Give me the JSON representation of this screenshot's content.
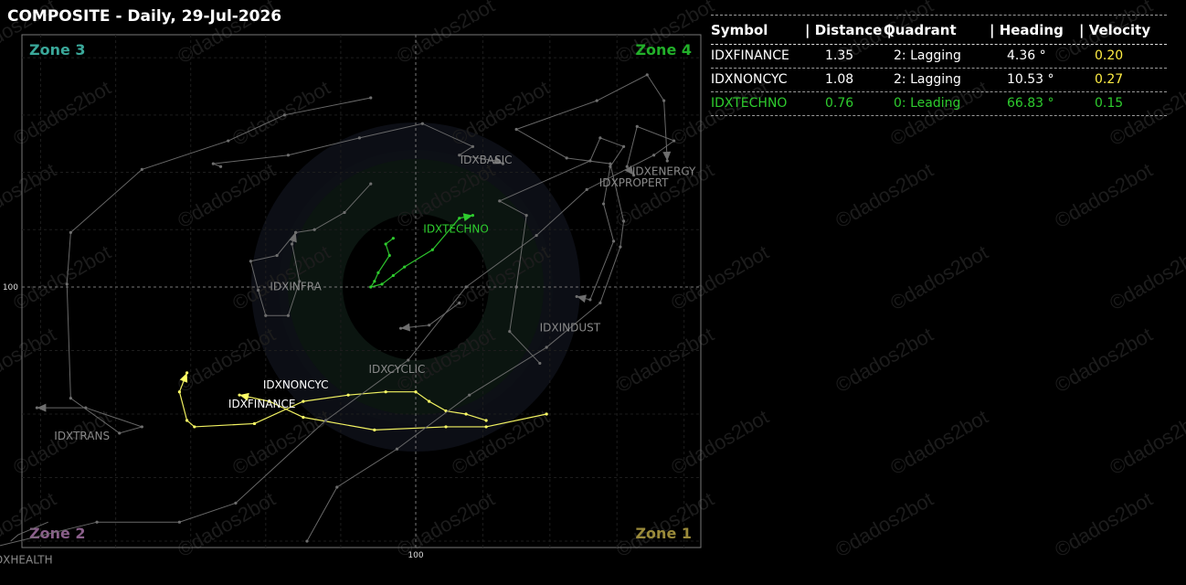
{
  "title": "COMPOSITE - Daily, 29-Jul-2026",
  "watermark": "©dados2bot",
  "chart_data": {
    "type": "scatter",
    "title": "COMPOSITE - Daily, 29-Jul-2026",
    "x_center": 100,
    "y_center": 100,
    "x_tick_label": "100",
    "y_tick_label": "100",
    "xlim": [
      -10.5,
      8.5
    ],
    "ylim": [
      -8.2,
      8.8
    ],
    "grid": true,
    "zones": [
      {
        "label": "Zone 3",
        "position": "top-left",
        "color": "#3aa89a"
      },
      {
        "label": "Zone 4",
        "position": "top-right",
        "color": "#22b02a"
      },
      {
        "label": "Zone 2",
        "position": "bottom-left",
        "color": "#8a5f8a"
      },
      {
        "label": "Zone 1",
        "position": "bottom-right",
        "color": "#9a8a3a"
      }
    ],
    "series": [
      {
        "name": "IDXFINANCE",
        "color": "#ffff66",
        "width": 1.2,
        "dots": true,
        "head": true,
        "points": [
          [
            3.9,
            -4
          ],
          [
            2.1,
            -4.4
          ],
          [
            0.9,
            -4.4
          ],
          [
            -1.1,
            -4.5
          ],
          [
            -3,
            -4.1
          ],
          [
            -3.9,
            -3.6
          ],
          [
            -4.7,
            -3.4
          ]
        ]
      },
      {
        "name": "IDXNONCYC",
        "color": "#ffff66",
        "width": 1.2,
        "dots": true,
        "head": true,
        "points": [
          [
            2.1,
            -4.2
          ],
          [
            1.5,
            -4
          ],
          [
            0.9,
            -3.9
          ],
          [
            0.4,
            -3.6
          ],
          [
            0,
            -3.3
          ],
          [
            -0.8,
            -3.3
          ],
          [
            -1.8,
            -3.4
          ],
          [
            -3,
            -3.6
          ],
          [
            -4.3,
            -4.3
          ],
          [
            -5.9,
            -4.4
          ],
          [
            -6.1,
            -4.2
          ],
          [
            -6.3,
            -3.3
          ],
          [
            -6.1,
            -2.7
          ]
        ]
      },
      {
        "name": "IDXTECHNO",
        "color": "#2ecc2e",
        "width": 1.2,
        "dots": true,
        "head": true,
        "points": [
          [
            -0.6,
            1.7
          ],
          [
            -0.8,
            1.5
          ],
          [
            -0.7,
            1.1
          ],
          [
            -1,
            0.5
          ],
          [
            -1.1,
            0.2
          ],
          [
            -1.2,
            0
          ],
          [
            -0.9,
            0.1
          ],
          [
            -0.6,
            0.4
          ],
          [
            -0.3,
            0.7
          ],
          [
            0.5,
            1.3
          ],
          [
            1.3,
            2.4
          ],
          [
            1.7,
            2.5
          ]
        ]
      },
      {
        "name": "IDXBASIC",
        "color": "#6e6e6e",
        "width": 1,
        "dots": true,
        "head": true,
        "points": [
          [
            -5.2,
            4.2
          ],
          [
            -5.4,
            4.3
          ],
          [
            -3.4,
            4.6
          ],
          [
            -1.5,
            5.2
          ],
          [
            0.2,
            5.7
          ],
          [
            1.7,
            4.9
          ],
          [
            1.3,
            4.6
          ],
          [
            2.4,
            4.4
          ],
          [
            2.6,
            4.3
          ]
        ]
      },
      {
        "name": "IDXENERGY",
        "color": "#6e6e6e",
        "width": 1,
        "dots": true,
        "head": true,
        "points": [
          [
            -2.9,
            -8
          ],
          [
            -2.1,
            -6.3
          ],
          [
            -0.5,
            -5.1
          ],
          [
            1.6,
            -3.4
          ],
          [
            3.9,
            -1.9
          ],
          [
            5.5,
            -0.5
          ],
          [
            6.1,
            1.4
          ],
          [
            6.2,
            2.3
          ],
          [
            5.8,
            4.3
          ],
          [
            4.5,
            4.5
          ],
          [
            3,
            5.5
          ],
          [
            5.4,
            6.5
          ],
          [
            6.9,
            7.4
          ],
          [
            7.4,
            6.5
          ],
          [
            7.5,
            4.4
          ]
        ]
      },
      {
        "name": "IDXPROPERT",
        "color": "#6e6e6e",
        "width": 1,
        "dots": true,
        "head": true,
        "points": [
          [
            -11.3,
            -8.2
          ],
          [
            -8.5,
            -7.4
          ],
          [
            -6.3,
            -7.4
          ],
          [
            -4.8,
            -6.8
          ],
          [
            -2.4,
            -4.2
          ],
          [
            -0.2,
            -2.3
          ],
          [
            1.5,
            0
          ],
          [
            3.6,
            1.8
          ],
          [
            5.1,
            3.4
          ],
          [
            7.1,
            4.6
          ],
          [
            7.7,
            5.1
          ],
          [
            6.6,
            5.6
          ],
          [
            6.3,
            4.2
          ],
          [
            6.5,
            3.9
          ]
        ]
      },
      {
        "name": "IDXINFRA",
        "color": "#6e6e6e",
        "width": 1,
        "dots": true,
        "head": true,
        "points": [
          [
            -1.2,
            3.6
          ],
          [
            -1.9,
            2.6
          ],
          [
            -2.7,
            2
          ],
          [
            -3.2,
            1.9
          ],
          [
            -3.7,
            1.1
          ],
          [
            -4.4,
            0.9
          ],
          [
            -4.2,
            -0.1
          ],
          [
            -4,
            -0.9
          ],
          [
            -3.4,
            -0.9
          ],
          [
            -3.1,
            0.2
          ],
          [
            -3.3,
            1.5
          ],
          [
            -3.2,
            1.9
          ]
        ]
      },
      {
        "name": "IDXTRANS",
        "color": "#6e6e6e",
        "width": 1,
        "dots": true,
        "head": true,
        "points": [
          [
            -1.2,
            6.6
          ],
          [
            -3.5,
            6
          ],
          [
            -5,
            5.1
          ],
          [
            -7.3,
            4.1
          ],
          [
            -9.2,
            1.9
          ],
          [
            -9.3,
            0.1
          ],
          [
            -9.2,
            -3.5
          ],
          [
            -7.9,
            -4.6
          ],
          [
            -7.3,
            -4.4
          ],
          [
            -8.8,
            -3.8
          ],
          [
            -10.1,
            -3.8
          ]
        ]
      },
      {
        "name": "IDXINDUST",
        "color": "#6e6e6e",
        "width": 1,
        "dots": true,
        "head": true,
        "points": [
          [
            3.7,
            -2.4
          ],
          [
            2.8,
            -1.4
          ],
          [
            3,
            0
          ],
          [
            3.3,
            2.5
          ],
          [
            2.5,
            3
          ],
          [
            5.2,
            4.4
          ],
          [
            5.5,
            5.2
          ],
          [
            6.2,
            4.9
          ],
          [
            5.8,
            4.2
          ],
          [
            5.6,
            2.9
          ],
          [
            5.9,
            1.6
          ],
          [
            5.2,
            -0.4
          ],
          [
            4.8,
            -0.3
          ]
        ]
      },
      {
        "name": "IDXCYCLIC",
        "color": "#6e6e6e",
        "width": 1,
        "dots": true,
        "head": true,
        "points": [
          [
            1.3,
            -0.5
          ],
          [
            0.4,
            -1.2
          ],
          [
            -0.4,
            -1.3
          ]
        ]
      },
      {
        "name": "IDXHEALTH",
        "color": "#6e6e6e",
        "width": 1,
        "dots": false,
        "head": false,
        "points": [
          [
            -9.8,
            -7.4
          ],
          [
            -10.6,
            -7.8
          ],
          [
            -10.8,
            -8
          ]
        ]
      }
    ],
    "labels": [
      {
        "text": "IDXBASIC",
        "x": 2.1,
        "y": 4.3,
        "color": "#8a8a8a"
      },
      {
        "text": "IDXENERGY",
        "x": 7.4,
        "y": 3.9,
        "color": "#8a8a8a"
      },
      {
        "text": "IDXPROPERT",
        "x": 6.5,
        "y": 3.5,
        "color": "#8a8a8a"
      },
      {
        "text": "IDXTECHNO",
        "x": 1.2,
        "y": 1.9,
        "color": "#2ecc2e"
      },
      {
        "text": "IDXINFRA",
        "x": -3.2,
        "y": -0.1,
        "color": "#8a8a8a"
      },
      {
        "text": "IDXINDUST",
        "x": 4.6,
        "y": -1.4,
        "color": "#8a8a8a"
      },
      {
        "text": "IDXCYCLIC",
        "x": -0.5,
        "y": -2.7,
        "color": "#8a8a8a"
      },
      {
        "text": "IDXNONCYC",
        "x": -3.2,
        "y": -3.2,
        "color": "#ffffff"
      },
      {
        "text": "IDXFINANCE",
        "x": -4.1,
        "y": -3.8,
        "color": "#ffffff"
      },
      {
        "text": "IDXTRANS",
        "x": -8.9,
        "y": -4.8,
        "color": "#8a8a8a"
      },
      {
        "text": "IDXHEALTH",
        "x": -10.5,
        "y": -8.7,
        "color": "#8a8a8a"
      }
    ]
  },
  "table": {
    "headers": [
      "Symbol",
      "| Distance |",
      "Quadrant",
      "|  Heading",
      "|   Velocity"
    ],
    "rows": [
      {
        "symbol": "IDXFINANCE",
        "distance": "1.35",
        "quadrant": "2: Lagging",
        "heading": "4.36 °",
        "velocity": "0.20",
        "text_color": "#ffffff",
        "velocity_color": "#ffee44"
      },
      {
        "symbol": "IDXNONCYC",
        "distance": "1.08",
        "quadrant": "2: Lagging",
        "heading": "10.53 °",
        "velocity": "0.27",
        "text_color": "#ffffff",
        "velocity_color": "#ffee44"
      },
      {
        "symbol": "IDXTECHNO",
        "distance": "0.76",
        "quadrant": "0: Leading",
        "heading": "66.83 °",
        "velocity": "0.15",
        "text_color": "#2ecc2e",
        "velocity_color": "#2ecc2e"
      }
    ]
  }
}
